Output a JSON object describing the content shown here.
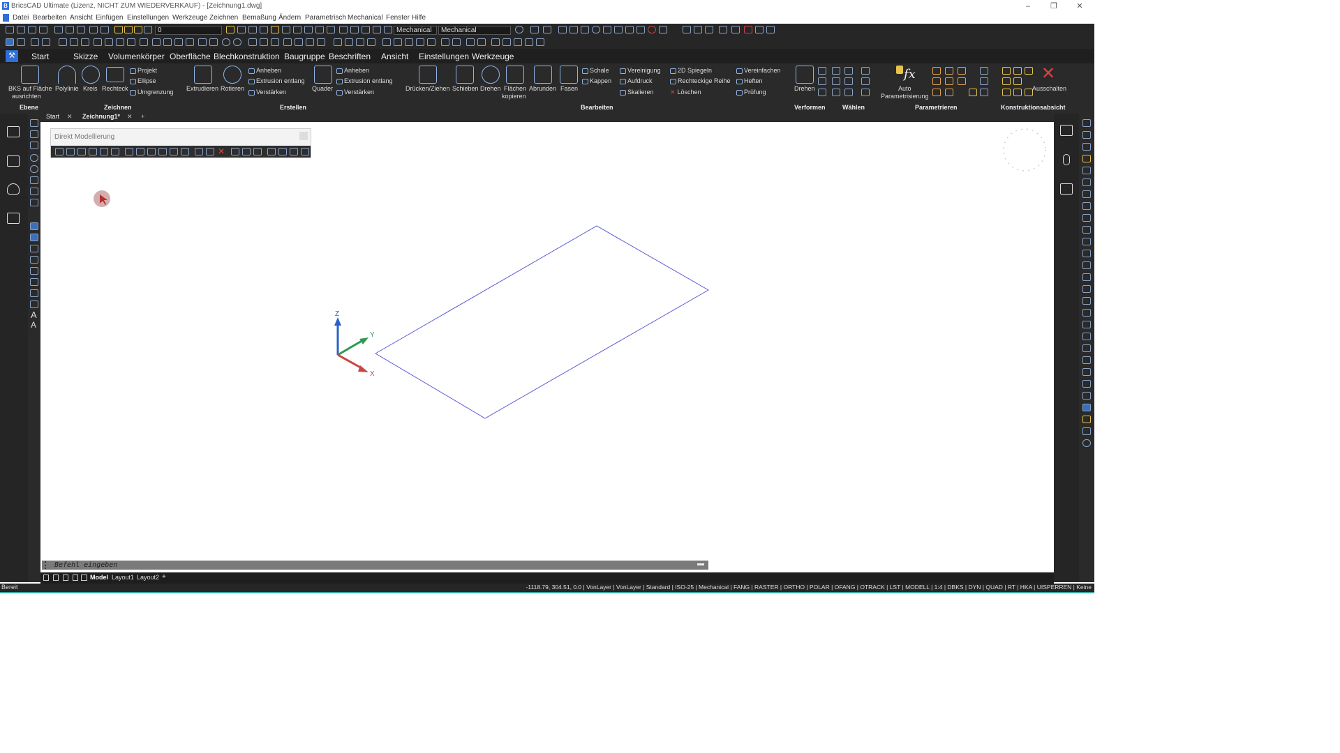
{
  "title_bar": {
    "logo": "B",
    "title": "BricsCAD Ultimate (Lizenz, NICHT ZUM WIEDERVERKAUF) - [Zeichnung1.dwg]",
    "minimize": "–",
    "restore": "❐",
    "close": "✕"
  },
  "menu": {
    "items": [
      "Datei",
      "Bearbeiten",
      "Ansicht",
      "Einfügen",
      "Einstellungen",
      "Werkzeuge",
      "Zeichnen",
      "Bemaßung",
      "Ändern",
      "Parametrisch",
      "Mechanical",
      "Fenster",
      "Hilfe"
    ]
  },
  "toolbar": {
    "layer_value": "0",
    "workspace_value": "Mechanical",
    "visual_style_value": "Mechanical"
  },
  "ribbon_tabs": [
    "Start",
    "Skizze",
    "Volumenkörper",
    "Oberfläche",
    "Blechkonstruktion",
    "Baugruppe",
    "Beschriften",
    "Ansicht",
    "Einstellungen",
    "Werkzeuge"
  ],
  "ribbon": {
    "ebene": {
      "btn1": "BKS auf Fläche",
      "btn1b": "ausrichten",
      "group": "Ebene"
    },
    "zeichnen": {
      "polylinie": "Polylinie",
      "kreis": "Kreis",
      "rechteck": "Rechteck",
      "projekt": "Projekt",
      "ellipse": "Ellipse",
      "umgrenzung": "Umgrenzung",
      "group": "Zeichnen"
    },
    "erstellen": {
      "extrudieren": "Extrudieren",
      "rotieren": "Rotieren",
      "anheben": "Anheben",
      "extrusion": "Extrusion entlang",
      "verstaerken": "Verstärken",
      "quader": "Quader",
      "anheben2": "Anheben",
      "extrusion2": "Extrusion entlang",
      "verstaerken2": "Verstärken",
      "group": "Erstellen"
    },
    "bearbeiten": {
      "druecken": "Drücken/Ziehen",
      "schieben": "Schieben",
      "drehen": "Drehen",
      "flaechen": "Flächen",
      "kopieren": "kopieren",
      "abrunden": "Abrunden",
      "fasen": "Fasen",
      "schale": "Schale",
      "kappen": "Kappen",
      "vereinigung": "Vereinigung",
      "aufdruck": "Aufdruck",
      "skalieren": "Skalieren",
      "spiegeln": "2D Spiegeln",
      "reihe": "Rechteckige Reihe",
      "loeschen": "Löschen",
      "vereinfachen": "Vereinfachen",
      "heften": "Heften",
      "pruefung": "Prüfung",
      "group": "Bearbeiten"
    },
    "verformen": {
      "drehen": "Drehen",
      "group": "Verformen"
    },
    "waehlen": {
      "group": "Wählen"
    },
    "parametrieren": {
      "auto": "Auto",
      "param": "Parametrisierung",
      "group": "Parametrieren"
    },
    "konstruktion": {
      "ausschalten": "Ausschalten",
      "group": "Konstruktionsabsicht"
    }
  },
  "doc_tabs": {
    "start": "Start",
    "drawing": "Zeichnung1*",
    "close": "✕",
    "add": "+"
  },
  "floating_toolbar": {
    "title": "Direkt Modellierung"
  },
  "ucs": {
    "z": "Z",
    "y": "Y",
    "x": "X"
  },
  "command_line": {
    "prompt": "Befehl eingeben"
  },
  "layout_tabs": {
    "model": "Model",
    "layout1": "Layout1",
    "layout2": "Layout2",
    "add": "+"
  },
  "status": {
    "left": "Bereit",
    "right": "-1118.79, 304.51, 0.0 | VonLayer | VonLayer | Standard | ISO-25 | Mechanical | FANG | RASTER | ORTHO | POLAR | OFANG | OTRACK | LST | MODELL | 1:4 | DBKS | DYN | QUAD | RT | HKA | UISPERREN | Keine"
  },
  "colors": {
    "dark": "#262626",
    "accent": "#2f6fd8",
    "rect": "#5b5bd6",
    "z_axis": "#2a62c9",
    "y_axis": "#2e9a53",
    "x_axis": "#c94545"
  }
}
